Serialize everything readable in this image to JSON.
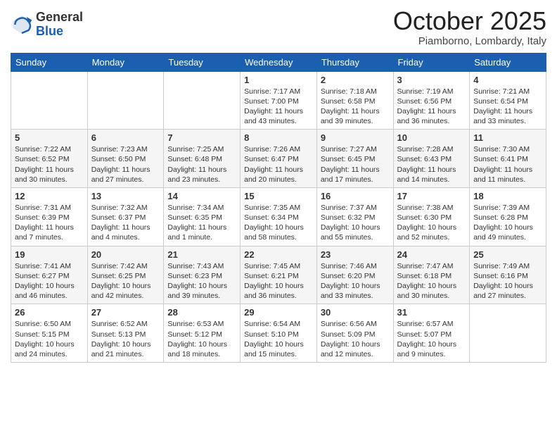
{
  "header": {
    "logo": {
      "general": "General",
      "blue": "Blue"
    },
    "title": "October 2025",
    "location": "Piamborno, Lombardy, Italy"
  },
  "days_of_week": [
    "Sunday",
    "Monday",
    "Tuesday",
    "Wednesday",
    "Thursday",
    "Friday",
    "Saturday"
  ],
  "weeks": [
    {
      "days": [
        {
          "number": "",
          "content": ""
        },
        {
          "number": "",
          "content": ""
        },
        {
          "number": "",
          "content": ""
        },
        {
          "number": "1",
          "content": "Sunrise: 7:17 AM\nSunset: 7:00 PM\nDaylight: 11 hours and 43 minutes."
        },
        {
          "number": "2",
          "content": "Sunrise: 7:18 AM\nSunset: 6:58 PM\nDaylight: 11 hours and 39 minutes."
        },
        {
          "number": "3",
          "content": "Sunrise: 7:19 AM\nSunset: 6:56 PM\nDaylight: 11 hours and 36 minutes."
        },
        {
          "number": "4",
          "content": "Sunrise: 7:21 AM\nSunset: 6:54 PM\nDaylight: 11 hours and 33 minutes."
        }
      ]
    },
    {
      "days": [
        {
          "number": "5",
          "content": "Sunrise: 7:22 AM\nSunset: 6:52 PM\nDaylight: 11 hours and 30 minutes."
        },
        {
          "number": "6",
          "content": "Sunrise: 7:23 AM\nSunset: 6:50 PM\nDaylight: 11 hours and 27 minutes."
        },
        {
          "number": "7",
          "content": "Sunrise: 7:25 AM\nSunset: 6:48 PM\nDaylight: 11 hours and 23 minutes."
        },
        {
          "number": "8",
          "content": "Sunrise: 7:26 AM\nSunset: 6:47 PM\nDaylight: 11 hours and 20 minutes."
        },
        {
          "number": "9",
          "content": "Sunrise: 7:27 AM\nSunset: 6:45 PM\nDaylight: 11 hours and 17 minutes."
        },
        {
          "number": "10",
          "content": "Sunrise: 7:28 AM\nSunset: 6:43 PM\nDaylight: 11 hours and 14 minutes."
        },
        {
          "number": "11",
          "content": "Sunrise: 7:30 AM\nSunset: 6:41 PM\nDaylight: 11 hours and 11 minutes."
        }
      ]
    },
    {
      "days": [
        {
          "number": "12",
          "content": "Sunrise: 7:31 AM\nSunset: 6:39 PM\nDaylight: 11 hours and 7 minutes."
        },
        {
          "number": "13",
          "content": "Sunrise: 7:32 AM\nSunset: 6:37 PM\nDaylight: 11 hours and 4 minutes."
        },
        {
          "number": "14",
          "content": "Sunrise: 7:34 AM\nSunset: 6:35 PM\nDaylight: 11 hours and 1 minute."
        },
        {
          "number": "15",
          "content": "Sunrise: 7:35 AM\nSunset: 6:34 PM\nDaylight: 10 hours and 58 minutes."
        },
        {
          "number": "16",
          "content": "Sunrise: 7:37 AM\nSunset: 6:32 PM\nDaylight: 10 hours and 55 minutes."
        },
        {
          "number": "17",
          "content": "Sunrise: 7:38 AM\nSunset: 6:30 PM\nDaylight: 10 hours and 52 minutes."
        },
        {
          "number": "18",
          "content": "Sunrise: 7:39 AM\nSunset: 6:28 PM\nDaylight: 10 hours and 49 minutes."
        }
      ]
    },
    {
      "days": [
        {
          "number": "19",
          "content": "Sunrise: 7:41 AM\nSunset: 6:27 PM\nDaylight: 10 hours and 46 minutes."
        },
        {
          "number": "20",
          "content": "Sunrise: 7:42 AM\nSunset: 6:25 PM\nDaylight: 10 hours and 42 minutes."
        },
        {
          "number": "21",
          "content": "Sunrise: 7:43 AM\nSunset: 6:23 PM\nDaylight: 10 hours and 39 minutes."
        },
        {
          "number": "22",
          "content": "Sunrise: 7:45 AM\nSunset: 6:21 PM\nDaylight: 10 hours and 36 minutes."
        },
        {
          "number": "23",
          "content": "Sunrise: 7:46 AM\nSunset: 6:20 PM\nDaylight: 10 hours and 33 minutes."
        },
        {
          "number": "24",
          "content": "Sunrise: 7:47 AM\nSunset: 6:18 PM\nDaylight: 10 hours and 30 minutes."
        },
        {
          "number": "25",
          "content": "Sunrise: 7:49 AM\nSunset: 6:16 PM\nDaylight: 10 hours and 27 minutes."
        }
      ]
    },
    {
      "days": [
        {
          "number": "26",
          "content": "Sunrise: 6:50 AM\nSunset: 5:15 PM\nDaylight: 10 hours and 24 minutes."
        },
        {
          "number": "27",
          "content": "Sunrise: 6:52 AM\nSunset: 5:13 PM\nDaylight: 10 hours and 21 minutes."
        },
        {
          "number": "28",
          "content": "Sunrise: 6:53 AM\nSunset: 5:12 PM\nDaylight: 10 hours and 18 minutes."
        },
        {
          "number": "29",
          "content": "Sunrise: 6:54 AM\nSunset: 5:10 PM\nDaylight: 10 hours and 15 minutes."
        },
        {
          "number": "30",
          "content": "Sunrise: 6:56 AM\nSunset: 5:09 PM\nDaylight: 10 hours and 12 minutes."
        },
        {
          "number": "31",
          "content": "Sunrise: 6:57 AM\nSunset: 5:07 PM\nDaylight: 10 hours and 9 minutes."
        },
        {
          "number": "",
          "content": ""
        }
      ]
    }
  ]
}
